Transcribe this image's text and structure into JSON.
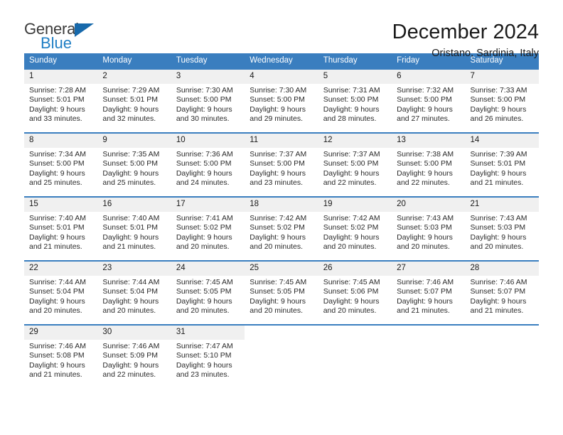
{
  "brand": {
    "name_part1": "General",
    "name_part2": "Blue",
    "accent_color": "#1769ab",
    "text_color": "#3a3a3a"
  },
  "header": {
    "title": "December 2024",
    "location": "Oristano, Sardinia, Italy"
  },
  "calendar": {
    "header_bg": "#3a7ebf",
    "daynum_bg": "#f0f0f0",
    "weekdays": [
      "Sunday",
      "Monday",
      "Tuesday",
      "Wednesday",
      "Thursday",
      "Friday",
      "Saturday"
    ],
    "weeks": [
      [
        {
          "day": "1",
          "sunrise": "Sunrise: 7:28 AM",
          "sunset": "Sunset: 5:01 PM",
          "daylight_line1": "Daylight: 9 hours",
          "daylight_line2": "and 33 minutes."
        },
        {
          "day": "2",
          "sunrise": "Sunrise: 7:29 AM",
          "sunset": "Sunset: 5:01 PM",
          "daylight_line1": "Daylight: 9 hours",
          "daylight_line2": "and 32 minutes."
        },
        {
          "day": "3",
          "sunrise": "Sunrise: 7:30 AM",
          "sunset": "Sunset: 5:00 PM",
          "daylight_line1": "Daylight: 9 hours",
          "daylight_line2": "and 30 minutes."
        },
        {
          "day": "4",
          "sunrise": "Sunrise: 7:30 AM",
          "sunset": "Sunset: 5:00 PM",
          "daylight_line1": "Daylight: 9 hours",
          "daylight_line2": "and 29 minutes."
        },
        {
          "day": "5",
          "sunrise": "Sunrise: 7:31 AM",
          "sunset": "Sunset: 5:00 PM",
          "daylight_line1": "Daylight: 9 hours",
          "daylight_line2": "and 28 minutes."
        },
        {
          "day": "6",
          "sunrise": "Sunrise: 7:32 AM",
          "sunset": "Sunset: 5:00 PM",
          "daylight_line1": "Daylight: 9 hours",
          "daylight_line2": "and 27 minutes."
        },
        {
          "day": "7",
          "sunrise": "Sunrise: 7:33 AM",
          "sunset": "Sunset: 5:00 PM",
          "daylight_line1": "Daylight: 9 hours",
          "daylight_line2": "and 26 minutes."
        }
      ],
      [
        {
          "day": "8",
          "sunrise": "Sunrise: 7:34 AM",
          "sunset": "Sunset: 5:00 PM",
          "daylight_line1": "Daylight: 9 hours",
          "daylight_line2": "and 25 minutes."
        },
        {
          "day": "9",
          "sunrise": "Sunrise: 7:35 AM",
          "sunset": "Sunset: 5:00 PM",
          "daylight_line1": "Daylight: 9 hours",
          "daylight_line2": "and 25 minutes."
        },
        {
          "day": "10",
          "sunrise": "Sunrise: 7:36 AM",
          "sunset": "Sunset: 5:00 PM",
          "daylight_line1": "Daylight: 9 hours",
          "daylight_line2": "and 24 minutes."
        },
        {
          "day": "11",
          "sunrise": "Sunrise: 7:37 AM",
          "sunset": "Sunset: 5:00 PM",
          "daylight_line1": "Daylight: 9 hours",
          "daylight_line2": "and 23 minutes."
        },
        {
          "day": "12",
          "sunrise": "Sunrise: 7:37 AM",
          "sunset": "Sunset: 5:00 PM",
          "daylight_line1": "Daylight: 9 hours",
          "daylight_line2": "and 22 minutes."
        },
        {
          "day": "13",
          "sunrise": "Sunrise: 7:38 AM",
          "sunset": "Sunset: 5:00 PM",
          "daylight_line1": "Daylight: 9 hours",
          "daylight_line2": "and 22 minutes."
        },
        {
          "day": "14",
          "sunrise": "Sunrise: 7:39 AM",
          "sunset": "Sunset: 5:01 PM",
          "daylight_line1": "Daylight: 9 hours",
          "daylight_line2": "and 21 minutes."
        }
      ],
      [
        {
          "day": "15",
          "sunrise": "Sunrise: 7:40 AM",
          "sunset": "Sunset: 5:01 PM",
          "daylight_line1": "Daylight: 9 hours",
          "daylight_line2": "and 21 minutes."
        },
        {
          "day": "16",
          "sunrise": "Sunrise: 7:40 AM",
          "sunset": "Sunset: 5:01 PM",
          "daylight_line1": "Daylight: 9 hours",
          "daylight_line2": "and 21 minutes."
        },
        {
          "day": "17",
          "sunrise": "Sunrise: 7:41 AM",
          "sunset": "Sunset: 5:02 PM",
          "daylight_line1": "Daylight: 9 hours",
          "daylight_line2": "and 20 minutes."
        },
        {
          "day": "18",
          "sunrise": "Sunrise: 7:42 AM",
          "sunset": "Sunset: 5:02 PM",
          "daylight_line1": "Daylight: 9 hours",
          "daylight_line2": "and 20 minutes."
        },
        {
          "day": "19",
          "sunrise": "Sunrise: 7:42 AM",
          "sunset": "Sunset: 5:02 PM",
          "daylight_line1": "Daylight: 9 hours",
          "daylight_line2": "and 20 minutes."
        },
        {
          "day": "20",
          "sunrise": "Sunrise: 7:43 AM",
          "sunset": "Sunset: 5:03 PM",
          "daylight_line1": "Daylight: 9 hours",
          "daylight_line2": "and 20 minutes."
        },
        {
          "day": "21",
          "sunrise": "Sunrise: 7:43 AM",
          "sunset": "Sunset: 5:03 PM",
          "daylight_line1": "Daylight: 9 hours",
          "daylight_line2": "and 20 minutes."
        }
      ],
      [
        {
          "day": "22",
          "sunrise": "Sunrise: 7:44 AM",
          "sunset": "Sunset: 5:04 PM",
          "daylight_line1": "Daylight: 9 hours",
          "daylight_line2": "and 20 minutes."
        },
        {
          "day": "23",
          "sunrise": "Sunrise: 7:44 AM",
          "sunset": "Sunset: 5:04 PM",
          "daylight_line1": "Daylight: 9 hours",
          "daylight_line2": "and 20 minutes."
        },
        {
          "day": "24",
          "sunrise": "Sunrise: 7:45 AM",
          "sunset": "Sunset: 5:05 PM",
          "daylight_line1": "Daylight: 9 hours",
          "daylight_line2": "and 20 minutes."
        },
        {
          "day": "25",
          "sunrise": "Sunrise: 7:45 AM",
          "sunset": "Sunset: 5:05 PM",
          "daylight_line1": "Daylight: 9 hours",
          "daylight_line2": "and 20 minutes."
        },
        {
          "day": "26",
          "sunrise": "Sunrise: 7:45 AM",
          "sunset": "Sunset: 5:06 PM",
          "daylight_line1": "Daylight: 9 hours",
          "daylight_line2": "and 20 minutes."
        },
        {
          "day": "27",
          "sunrise": "Sunrise: 7:46 AM",
          "sunset": "Sunset: 5:07 PM",
          "daylight_line1": "Daylight: 9 hours",
          "daylight_line2": "and 21 minutes."
        },
        {
          "day": "28",
          "sunrise": "Sunrise: 7:46 AM",
          "sunset": "Sunset: 5:07 PM",
          "daylight_line1": "Daylight: 9 hours",
          "daylight_line2": "and 21 minutes."
        }
      ],
      [
        {
          "day": "29",
          "sunrise": "Sunrise: 7:46 AM",
          "sunset": "Sunset: 5:08 PM",
          "daylight_line1": "Daylight: 9 hours",
          "daylight_line2": "and 21 minutes."
        },
        {
          "day": "30",
          "sunrise": "Sunrise: 7:46 AM",
          "sunset": "Sunset: 5:09 PM",
          "daylight_line1": "Daylight: 9 hours",
          "daylight_line2": "and 22 minutes."
        },
        {
          "day": "31",
          "sunrise": "Sunrise: 7:47 AM",
          "sunset": "Sunset: 5:10 PM",
          "daylight_line1": "Daylight: 9 hours",
          "daylight_line2": "and 23 minutes."
        },
        {
          "day": "",
          "sunrise": "",
          "sunset": "",
          "daylight_line1": "",
          "daylight_line2": ""
        },
        {
          "day": "",
          "sunrise": "",
          "sunset": "",
          "daylight_line1": "",
          "daylight_line2": ""
        },
        {
          "day": "",
          "sunrise": "",
          "sunset": "",
          "daylight_line1": "",
          "daylight_line2": ""
        },
        {
          "day": "",
          "sunrise": "",
          "sunset": "",
          "daylight_line1": "",
          "daylight_line2": ""
        }
      ]
    ]
  }
}
